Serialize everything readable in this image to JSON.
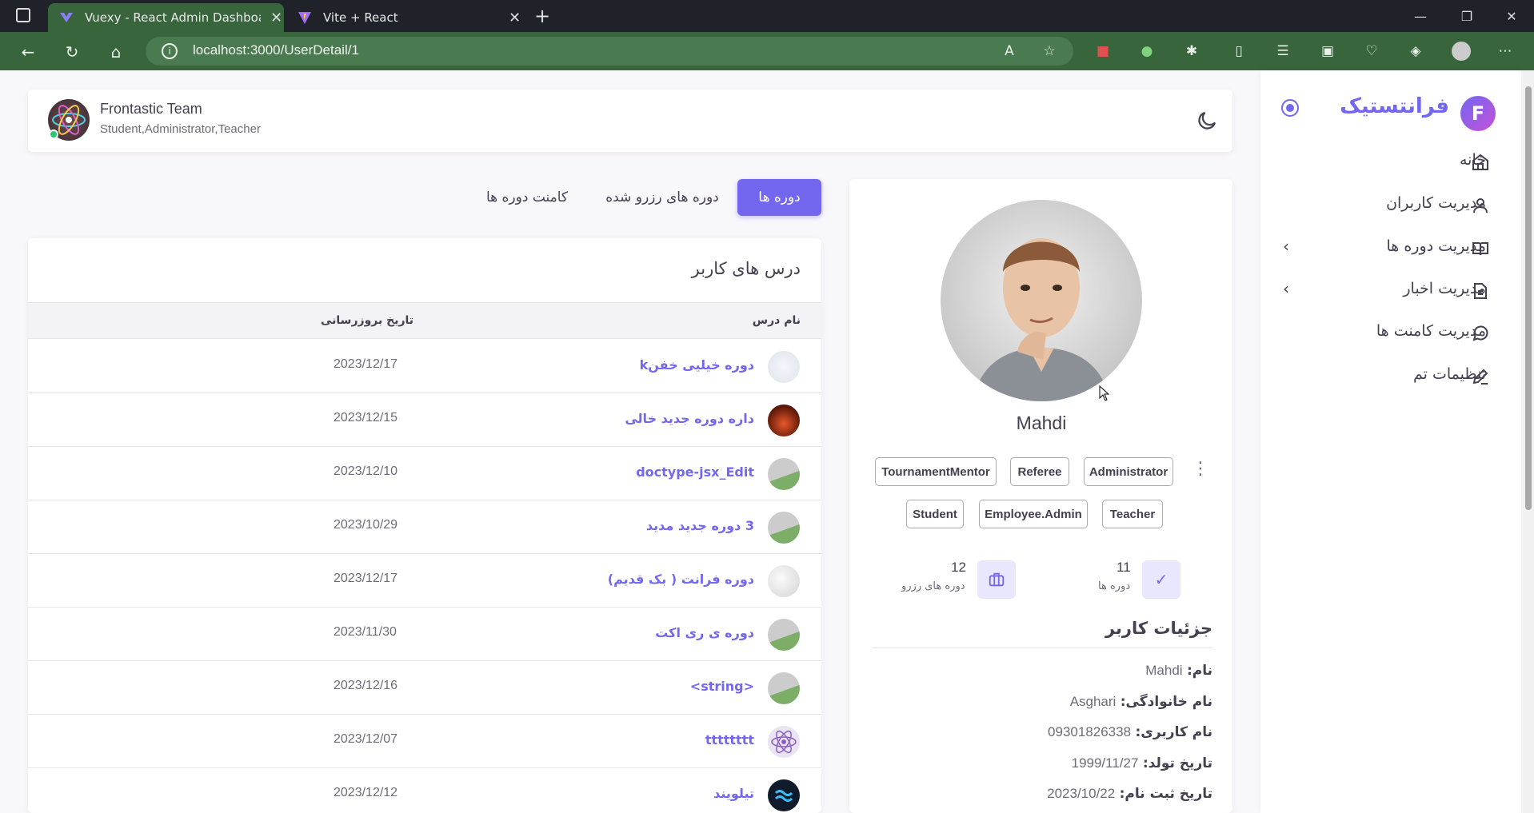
{
  "browser": {
    "tabs": [
      {
        "title": "Vuexy - React Admin Dashboard",
        "active": true
      },
      {
        "title": "Vite + React",
        "active": false
      }
    ],
    "url": "localhost:3000/UserDetail/1"
  },
  "sidebar": {
    "brand": "فرانتستیک",
    "brand_logo_letter": "F",
    "items": [
      {
        "label": "خانه",
        "icon": "home-icon"
      },
      {
        "label": "مدیریت کاربران",
        "icon": "user-icon"
      },
      {
        "label": "مدیریت دوره ها",
        "icon": "book-icon",
        "has_children": true
      },
      {
        "label": "مدیریت اخبار",
        "icon": "file-text-icon",
        "has_children": true
      },
      {
        "label": "مدیریت کامنت ها",
        "icon": "message-circle-icon"
      },
      {
        "label": "تنظیمات تم",
        "icon": "pen-icon"
      }
    ]
  },
  "header": {
    "team_name": "Frontastic Team",
    "team_roles": "Student,Administrator,Teacher"
  },
  "tabs": [
    {
      "label": "دوره ها",
      "active": true
    },
    {
      "label": "دوره های رزرو شده",
      "active": false
    },
    {
      "label": "کامنت دوره ها",
      "active": false
    }
  ],
  "courses_card": {
    "title": "درس های کاربر",
    "columns": {
      "name": "نام درس",
      "updated": "تاریخ بروزرسانی"
    },
    "rows": [
      {
        "name": "دوره خیلیی خفنk",
        "date": "2023/12/17",
        "thumb": "blank"
      },
      {
        "name": "داره دوره جدید خالی",
        "date": "2023/12/15",
        "thumb": "fire"
      },
      {
        "name": "doctype-jsx_Edit",
        "date": "2023/12/10",
        "thumb": "png"
      },
      {
        "name": "3 دوره جدید مدید",
        "date": "2023/10/29",
        "thumb": "png"
      },
      {
        "name": "دوره فرانت ( بک قدیم)",
        "date": "2023/12/17",
        "thumb": "blank"
      },
      {
        "name": "دوره ی ری اکت",
        "date": "2023/11/30",
        "thumb": "png"
      },
      {
        "name": "<string>",
        "date": "2023/12/16",
        "thumb": "png"
      },
      {
        "name": "tttttttt",
        "date": "2023/12/07",
        "thumb": "atom"
      },
      {
        "name": "تیلویند",
        "date": "2023/12/12",
        "thumb": "tailwind"
      }
    ]
  },
  "profile": {
    "name": "Mahdi",
    "roles_row1": [
      "TournamentMentor",
      "Referee",
      "Administrator"
    ],
    "roles_row2": [
      "Student",
      "Employee.Admin",
      "Teacher"
    ],
    "stats": [
      {
        "value": "11",
        "label": "دوره ها",
        "icon": "check-icon"
      },
      {
        "value": "12",
        "label": "دوره های رزرو",
        "icon": "briefcase-icon"
      }
    ],
    "details_title": "جزئیات کاربر",
    "details": [
      {
        "label": "نام:",
        "value": "Mahdi"
      },
      {
        "label": "نام خانوادگی:",
        "value": "Asghari"
      },
      {
        "label": "نام کاربری:",
        "value": "09301826338"
      },
      {
        "label": "تاریخ تولد:",
        "value": "1999/11/27"
      },
      {
        "label": "تاریخ ثبت نام:",
        "value": "2023/10/22"
      }
    ]
  },
  "colors": {
    "accent": "#7367f0",
    "browser_green": "#38653c",
    "online": "#28c76f"
  }
}
